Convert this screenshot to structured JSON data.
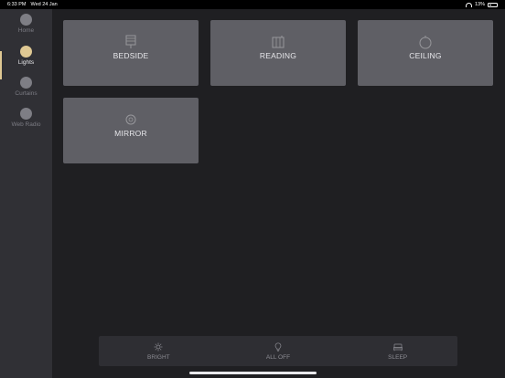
{
  "status_bar": {
    "time": "6:33 PM",
    "date": "Wed 24 Jan",
    "battery": "13%"
  },
  "sidebar": {
    "items": [
      {
        "label": "Home",
        "icon": "home-icon",
        "active": false
      },
      {
        "label": "Lights",
        "icon": "lights-icon",
        "active": true
      },
      {
        "label": "Curtains",
        "icon": "curtains-icon",
        "active": false
      },
      {
        "label": "Web Radio",
        "icon": "radio-icon",
        "active": false
      }
    ],
    "accent_color": "#dfc893"
  },
  "tiles": [
    {
      "label": "BEDSIDE",
      "icon": "lamp-icon"
    },
    {
      "label": "READING",
      "icon": "reading-lamp-icon"
    },
    {
      "label": "CEILING",
      "icon": "ceiling-light-icon"
    },
    {
      "label": "MIRROR",
      "icon": "mirror-light-icon"
    }
  ],
  "toolbar": {
    "items": [
      {
        "label": "BRIGHT",
        "icon": "sun-icon"
      },
      {
        "label": "ALL OFF",
        "icon": "bulb-icon"
      },
      {
        "label": "SLEEP",
        "icon": "bed-icon"
      }
    ]
  }
}
